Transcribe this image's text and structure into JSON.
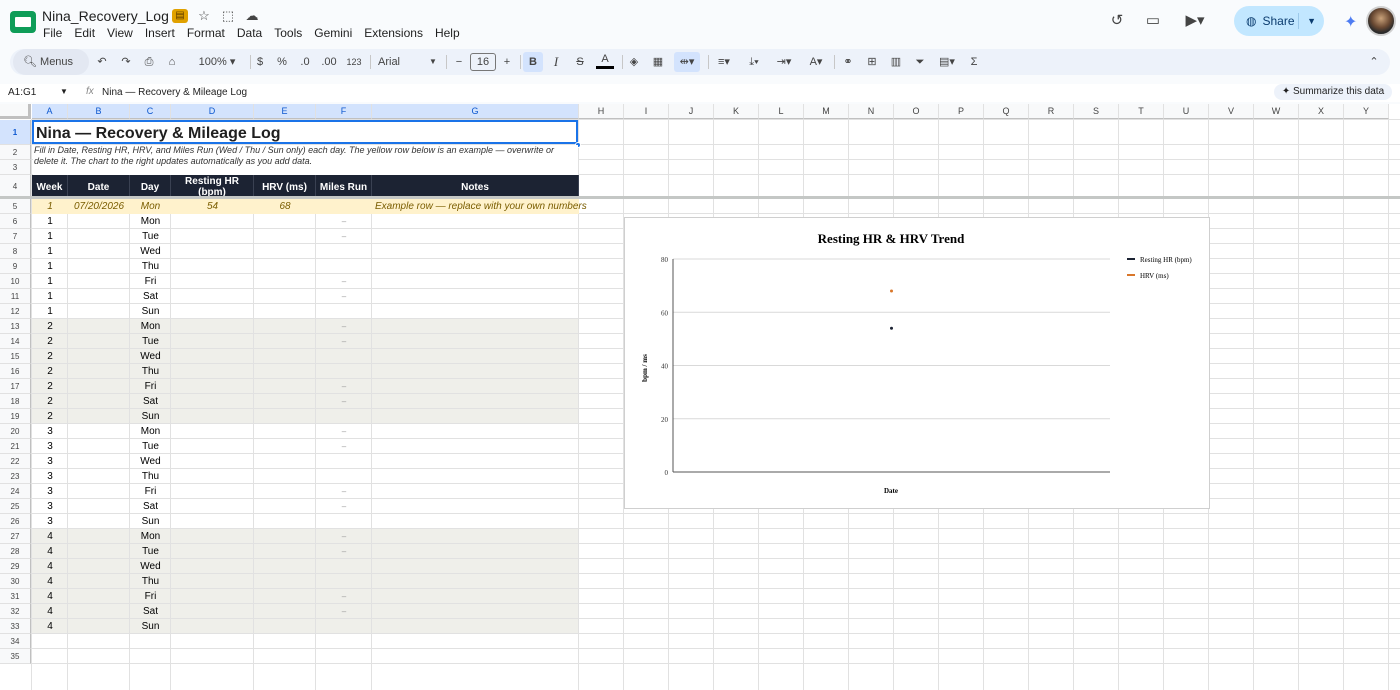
{
  "app": {
    "doc_title": "Nina_Recovery_Log",
    "share_label": "Share"
  },
  "menu": [
    "File",
    "Edit",
    "View",
    "Insert",
    "Format",
    "Data",
    "Tools",
    "Gemini",
    "Extensions",
    "Help"
  ],
  "toolbar": {
    "search_label": "Menus",
    "zoom": "100%",
    "currency": "$",
    "percent": "%",
    "dec_less": ".0",
    "dec_more": ".00",
    "number_format": "123",
    "font": "Arial",
    "font_size": "16"
  },
  "formula_bar": {
    "range": "A1:G1",
    "content": "Nina — Recovery & Mileage Log",
    "summarize_label": "Summarize this data"
  },
  "columns": [
    "A",
    "B",
    "C",
    "D",
    "E",
    "F",
    "G",
    "H",
    "I",
    "J",
    "K",
    "L",
    "M",
    "N",
    "O",
    "P",
    "Q",
    "R",
    "S",
    "T",
    "U",
    "V",
    "W",
    "X",
    "Y"
  ],
  "rows": [
    "1",
    "2",
    "3",
    "4",
    "5",
    "6",
    "7",
    "8",
    "9",
    "10",
    "11",
    "12",
    "13",
    "14",
    "15",
    "16",
    "17",
    "18",
    "19",
    "20",
    "21",
    "22",
    "23",
    "24",
    "25",
    "26",
    "27",
    "28",
    "29",
    "30",
    "31",
    "32",
    "33",
    "34",
    "35"
  ],
  "sheet": {
    "title": "Nina — Recovery & Mileage Log",
    "instructions": "Fill in Date, Resting HR, HRV, and Miles Run (Wed / Thu / Sun only) each day. The yellow row below is an example — overwrite or delete it. The chart to the right updates automatically as you add data.",
    "headers": [
      "Week",
      "Date",
      "Day",
      "Resting HR (bpm)",
      "HRV (ms)",
      "Miles Run",
      "Notes"
    ],
    "example_row": {
      "week": "1",
      "date": "07/20/2026",
      "day": "Mon",
      "resting_hr": "54",
      "hrv": "68",
      "notes": "Example row — replace with your own numbers"
    },
    "log_rows": [
      {
        "week": "1",
        "day": "Mon",
        "miles": "–"
      },
      {
        "week": "1",
        "day": "Tue",
        "miles": "–"
      },
      {
        "week": "1",
        "day": "Wed",
        "miles": ""
      },
      {
        "week": "1",
        "day": "Thu",
        "miles": ""
      },
      {
        "week": "1",
        "day": "Fri",
        "miles": "–"
      },
      {
        "week": "1",
        "day": "Sat",
        "miles": "–"
      },
      {
        "week": "1",
        "day": "Sun",
        "miles": ""
      },
      {
        "week": "2",
        "day": "Mon",
        "miles": "–"
      },
      {
        "week": "2",
        "day": "Tue",
        "miles": "–"
      },
      {
        "week": "2",
        "day": "Wed",
        "miles": ""
      },
      {
        "week": "2",
        "day": "Thu",
        "miles": ""
      },
      {
        "week": "2",
        "day": "Fri",
        "miles": "–"
      },
      {
        "week": "2",
        "day": "Sat",
        "miles": "–"
      },
      {
        "week": "2",
        "day": "Sun",
        "miles": ""
      },
      {
        "week": "3",
        "day": "Mon",
        "miles": "–"
      },
      {
        "week": "3",
        "day": "Tue",
        "miles": "–"
      },
      {
        "week": "3",
        "day": "Wed",
        "miles": ""
      },
      {
        "week": "3",
        "day": "Thu",
        "miles": ""
      },
      {
        "week": "3",
        "day": "Fri",
        "miles": "–"
      },
      {
        "week": "3",
        "day": "Sat",
        "miles": "–"
      },
      {
        "week": "3",
        "day": "Sun",
        "miles": ""
      },
      {
        "week": "4",
        "day": "Mon",
        "miles": "–"
      },
      {
        "week": "4",
        "day": "Tue",
        "miles": "–"
      },
      {
        "week": "4",
        "day": "Wed",
        "miles": ""
      },
      {
        "week": "4",
        "day": "Thu",
        "miles": ""
      },
      {
        "week": "4",
        "day": "Fri",
        "miles": "–"
      },
      {
        "week": "4",
        "day": "Sat",
        "miles": "–"
      },
      {
        "week": "4",
        "day": "Sun",
        "miles": ""
      }
    ]
  },
  "colors": {
    "header_bg": "#1c2333",
    "example_bg": "#fff2cc",
    "alt_week_bg": "#efefea",
    "hr_series": "#1c2333",
    "hrv_series": "#d9772b"
  },
  "chart_data": {
    "type": "scatter",
    "title": "Resting HR & HRV Trend",
    "xlabel": "Date",
    "ylabel": "bpm / ms",
    "ylim": [
      0,
      80
    ],
    "yticks": [
      "0",
      "20",
      "40",
      "60",
      "80"
    ],
    "grid": true,
    "legend": "top-right",
    "series": [
      {
        "name": "Resting HR (bpm)",
        "x": [
          "07/20/2026"
        ],
        "values": [
          54
        ],
        "color": "#1c2333"
      },
      {
        "name": "HRV (ms)",
        "x": [
          "07/20/2026"
        ],
        "values": [
          68
        ],
        "color": "#d9772b"
      }
    ]
  }
}
